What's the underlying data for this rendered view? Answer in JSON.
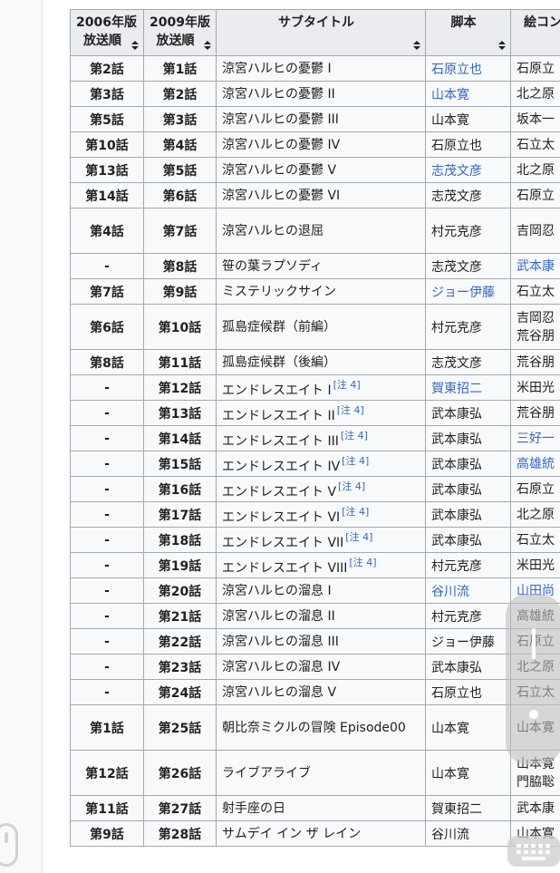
{
  "table": {
    "headers": {
      "col1": [
        "2006年版",
        "放送順"
      ],
      "col2": [
        "2009年版",
        "放送順"
      ],
      "col3": "サブタイトル",
      "col4": "脚本",
      "col5": "絵コンテ"
    },
    "note_label": "[注 4]",
    "rows": [
      {
        "y2006": "第2話",
        "y2009": "第1話",
        "title": "涼宮ハルヒの憂鬱 I",
        "script": "石原立也",
        "script_link": true,
        "story": "石原立",
        "story_link": false,
        "note": false,
        "tall": false
      },
      {
        "y2006": "第3話",
        "y2009": "第2話",
        "title": "涼宮ハルヒの憂鬱 II",
        "script": "山本寛",
        "script_link": true,
        "story": "北之原",
        "story_link": false,
        "note": false,
        "tall": false
      },
      {
        "y2006": "第5話",
        "y2009": "第3話",
        "title": "涼宮ハルヒの憂鬱 III",
        "script": "山本寛",
        "script_link": false,
        "story": "坂本一",
        "story_link": false,
        "note": false,
        "tall": false
      },
      {
        "y2006": "第10話",
        "y2009": "第4話",
        "title": "涼宮ハルヒの憂鬱 IV",
        "script": "石原立也",
        "script_link": false,
        "story": "石立太",
        "story_link": false,
        "note": false,
        "tall": false
      },
      {
        "y2006": "第13話",
        "y2009": "第5話",
        "title": "涼宮ハルヒの憂鬱 V",
        "script": "志茂文彦",
        "script_link": true,
        "story": "北之原",
        "story_link": false,
        "note": false,
        "tall": false
      },
      {
        "y2006": "第14話",
        "y2009": "第6話",
        "title": "涼宮ハルヒの憂鬱 VI",
        "script": "志茂文彦",
        "script_link": false,
        "story": "石原立",
        "story_link": false,
        "note": false,
        "tall": false
      },
      {
        "y2006": "第4話",
        "y2009": "第7話",
        "title": "涼宮ハルヒの退屈",
        "script": "村元克彦",
        "script_link": false,
        "story": "吉岡忍",
        "story_link": false,
        "note": false,
        "tall": true
      },
      {
        "y2006": "-",
        "y2009": "第8話",
        "title": "笹の葉ラプソディ",
        "script": "志茂文彦",
        "script_link": false,
        "story": "武本康",
        "story_link": true,
        "note": false,
        "tall": false
      },
      {
        "y2006": "第7話",
        "y2009": "第9話",
        "title": "ミステリックサイン",
        "script": "ジョー伊藤",
        "script_link": true,
        "story": "石立太",
        "story_link": false,
        "note": false,
        "tall": false
      },
      {
        "y2006": "第6話",
        "y2009": "第10話",
        "title": "孤島症候群（前編）",
        "script": "村元克彦",
        "script_link": false,
        "story": "吉岡忍",
        "story2": "荒谷朋",
        "story_link": false,
        "note": false,
        "tall": true
      },
      {
        "y2006": "第8話",
        "y2009": "第11話",
        "title": "孤島症候群（後編）",
        "script": "志茂文彦",
        "script_link": false,
        "story": "荒谷朋",
        "story_link": false,
        "note": false,
        "tall": false
      },
      {
        "y2006": "-",
        "y2009": "第12話",
        "title": "エンドレスエイト I",
        "script": "賀東招二",
        "script_link": true,
        "story": "米田光",
        "story_link": false,
        "note": true,
        "tall": false
      },
      {
        "y2006": "-",
        "y2009": "第13話",
        "title": "エンドレスエイト II",
        "script": "武本康弘",
        "script_link": false,
        "story": "荒谷朋",
        "story_link": false,
        "note": true,
        "tall": false
      },
      {
        "y2006": "-",
        "y2009": "第14話",
        "title": "エンドレスエイト III",
        "script": "武本康弘",
        "script_link": false,
        "story": "三好一",
        "story_link": true,
        "note": true,
        "tall": false
      },
      {
        "y2006": "-",
        "y2009": "第15話",
        "title": "エンドレスエイト IV",
        "script": "武本康弘",
        "script_link": false,
        "story": "高雄統",
        "story_link": true,
        "note": true,
        "tall": false
      },
      {
        "y2006": "-",
        "y2009": "第16話",
        "title": "エンドレスエイト V",
        "script": "武本康弘",
        "script_link": false,
        "story": "石原立",
        "story_link": false,
        "note": true,
        "tall": false
      },
      {
        "y2006": "-",
        "y2009": "第17話",
        "title": "エンドレスエイト VI",
        "script": "武本康弘",
        "script_link": false,
        "story": "北之原",
        "story_link": false,
        "note": true,
        "tall": false
      },
      {
        "y2006": "-",
        "y2009": "第18話",
        "title": "エンドレスエイト VII",
        "script": "武本康弘",
        "script_link": false,
        "story": "石立太",
        "story_link": false,
        "note": true,
        "tall": false
      },
      {
        "y2006": "-",
        "y2009": "第19話",
        "title": "エンドレスエイト VIII",
        "script": "村元克彦",
        "script_link": false,
        "story": "米田光",
        "story_link": false,
        "note": true,
        "tall": false
      },
      {
        "y2006": "-",
        "y2009": "第20話",
        "title": "涼宮ハルヒの溜息 I",
        "script": "谷川流",
        "script_link": true,
        "story": "山田尚",
        "story_link": true,
        "note": false,
        "tall": false
      },
      {
        "y2006": "-",
        "y2009": "第21話",
        "title": "涼宮ハルヒの溜息 II",
        "script": "村元克彦",
        "script_link": false,
        "story": "高雄統",
        "story_link": false,
        "note": false,
        "tall": false
      },
      {
        "y2006": "-",
        "y2009": "第22話",
        "title": "涼宮ハルヒの溜息 III",
        "script": "ジョー伊藤",
        "script_link": false,
        "story": "石原立",
        "story_link": false,
        "note": false,
        "tall": false
      },
      {
        "y2006": "-",
        "y2009": "第23話",
        "title": "涼宮ハルヒの溜息 IV",
        "script": "武本康弘",
        "script_link": false,
        "story": "北之原",
        "story_link": false,
        "note": false,
        "tall": false
      },
      {
        "y2006": "-",
        "y2009": "第24話",
        "title": "涼宮ハルヒの溜息 V",
        "script": "石原立也",
        "script_link": false,
        "story": "石立太",
        "story_link": false,
        "note": false,
        "tall": false
      },
      {
        "y2006": "第1話",
        "y2009": "第25話",
        "title": "朝比奈ミクルの冒険 Episode00",
        "script": "山本寛",
        "script_link": false,
        "story": "山本寛",
        "story_link": false,
        "note": false,
        "tall": true
      },
      {
        "y2006": "第12話",
        "y2009": "第26話",
        "title": "ライブアライブ",
        "script": "山本寛",
        "script_link": false,
        "story": "山本寛",
        "story2": "門脇聡",
        "story_link": false,
        "note": false,
        "tall": true
      },
      {
        "y2006": "第11話",
        "y2009": "第27話",
        "title": "射手座の日",
        "script": "賀東招二",
        "script_link": false,
        "story": "武本康",
        "story_link": false,
        "note": false,
        "tall": false
      },
      {
        "y2006": "第9話",
        "y2009": "第28話",
        "title": "サムデイ イン ザ レイン",
        "script": "谷川流",
        "script_link": false,
        "story": "山本寛",
        "story_link": false,
        "note": false,
        "tall": false
      }
    ]
  }
}
